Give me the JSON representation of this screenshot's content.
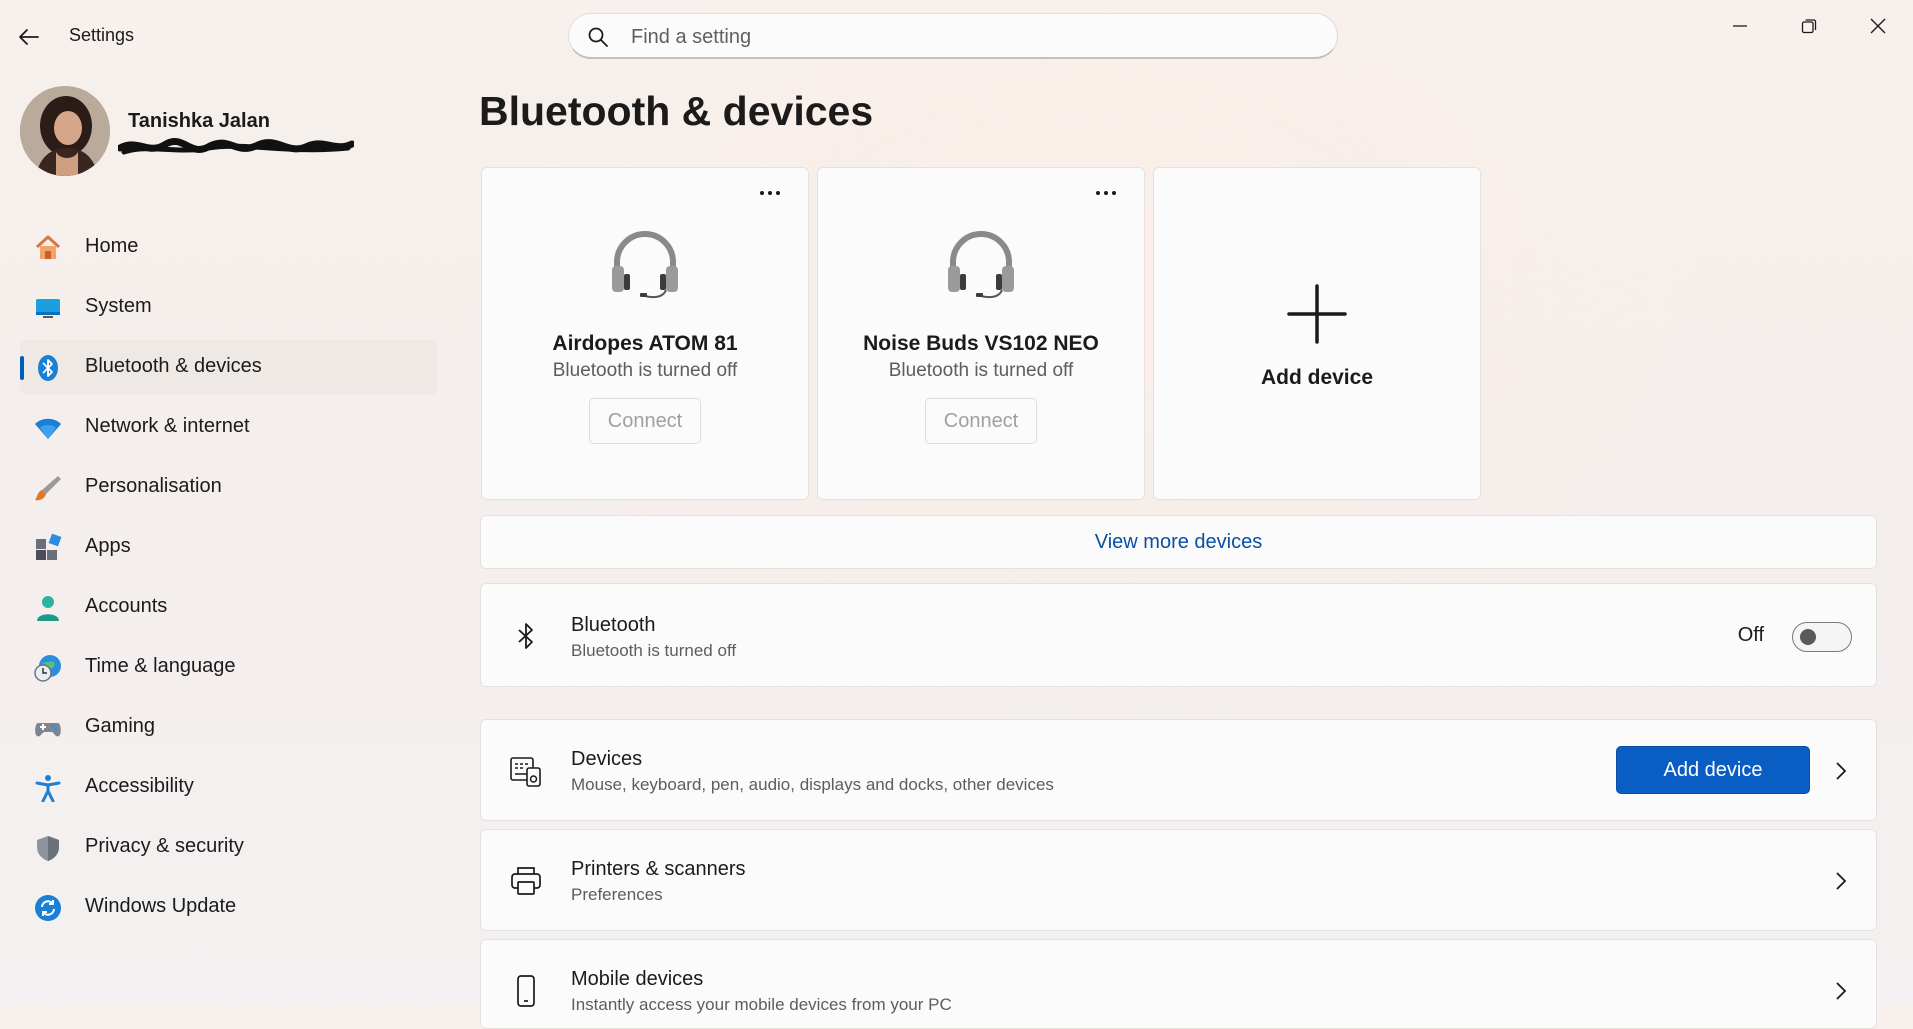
{
  "window": {
    "app_title": "Settings",
    "search_placeholder": "Find a setting"
  },
  "profile": {
    "name": "Tanishka Jalan"
  },
  "nav": [
    {
      "label": "Home",
      "icon": "home-icon"
    },
    {
      "label": "System",
      "icon": "system-icon"
    },
    {
      "label": "Bluetooth & devices",
      "icon": "bluetooth-icon",
      "active": true
    },
    {
      "label": "Network & internet",
      "icon": "wifi-icon"
    },
    {
      "label": "Personalisation",
      "icon": "brush-icon"
    },
    {
      "label": "Apps",
      "icon": "apps-icon"
    },
    {
      "label": "Accounts",
      "icon": "accounts-icon"
    },
    {
      "label": "Time & language",
      "icon": "globe-clock-icon"
    },
    {
      "label": "Gaming",
      "icon": "gamepad-icon"
    },
    {
      "label": "Accessibility",
      "icon": "accessibility-icon"
    },
    {
      "label": "Privacy & security",
      "icon": "shield-icon"
    },
    {
      "label": "Windows Update",
      "icon": "update-icon"
    }
  ],
  "main": {
    "title": "Bluetooth & devices",
    "device_cards": [
      {
        "name": "Airdopes ATOM 81",
        "status": "Bluetooth is turned off",
        "button": "Connect"
      },
      {
        "name": "Noise Buds VS102 NEO",
        "status": "Bluetooth is turned off",
        "button": "Connect"
      }
    ],
    "add_device_card_label": "Add device",
    "view_more_label": "View more devices",
    "bluetooth_row": {
      "title": "Bluetooth",
      "subtitle": "Bluetooth is turned off",
      "toggle_label": "Off",
      "toggle_on": false
    },
    "devices_row": {
      "title": "Devices",
      "subtitle": "Mouse, keyboard, pen, audio, displays and docks, other devices",
      "button": "Add device"
    },
    "printers_row": {
      "title": "Printers & scanners",
      "subtitle": "Preferences"
    },
    "mobile_row": {
      "title": "Mobile devices",
      "subtitle": "Instantly access your mobile devices from your PC"
    }
  },
  "colors": {
    "accent": "#005fb8",
    "primary_button": "#0a5dc2",
    "link": "#0b4fa5"
  }
}
